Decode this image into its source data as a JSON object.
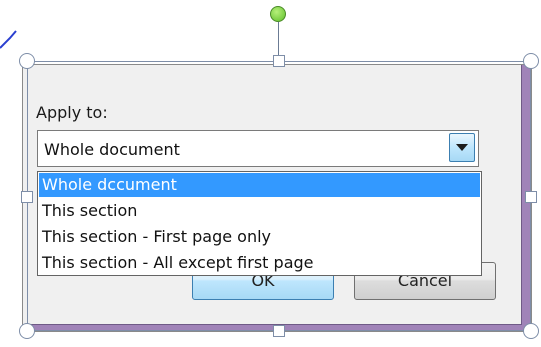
{
  "dialog": {
    "apply_label": "Apply to:",
    "combo_value": "Whole document",
    "combo_arrow_icon": "chevron-down-icon",
    "ok_label": "OK",
    "cancel_label": "Cancel"
  },
  "dropdown": {
    "options": [
      "Whole dccument",
      "This section",
      "This section - First page only",
      "This section - All except first page"
    ],
    "selected_index": 0
  },
  "selection": {
    "rotate_handle_icon": "rotate-handle-icon",
    "handle_icon": "resize-handle-icon"
  },
  "colors": {
    "selected_bg": "#3399ff",
    "frame_accent": "#a083b8",
    "rotate_handle": "#5fbf2a"
  }
}
